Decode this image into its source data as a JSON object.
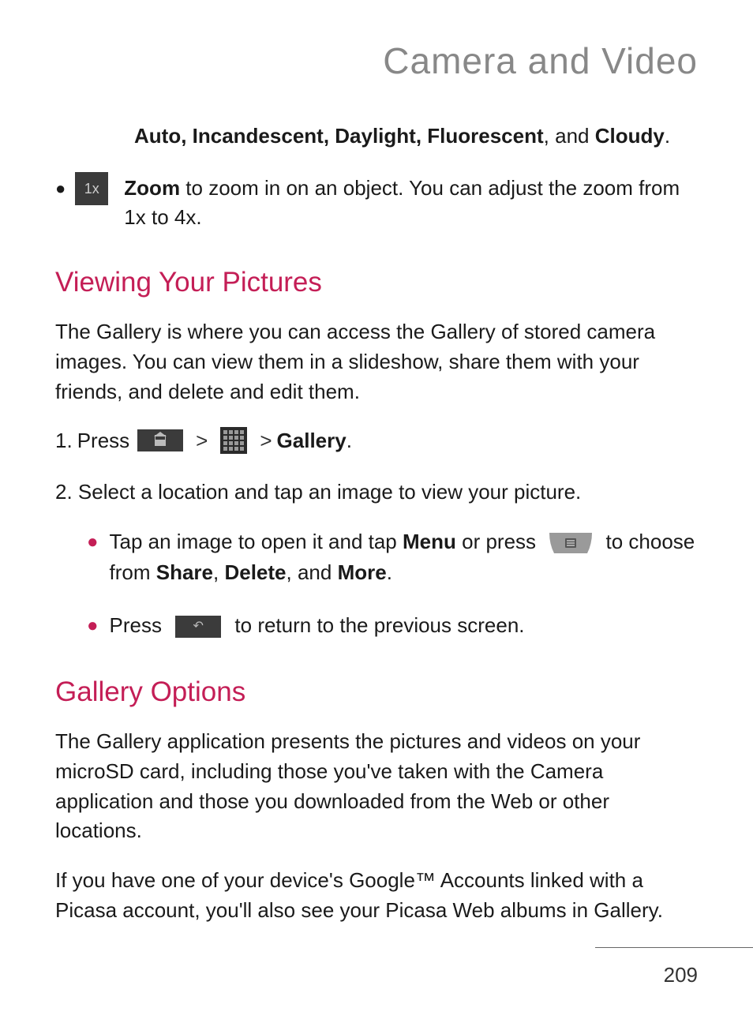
{
  "header": {
    "title": "Camera and Video"
  },
  "top_line": {
    "bold_part": "Auto, Incandescent, Daylight, Fluorescent",
    "rest": ", and ",
    "bold_end": "Cloudy",
    "period": "."
  },
  "zoom": {
    "icon_label": "1x",
    "bold": "Zoom",
    "text": " to zoom in on an object. You can adjust the zoom from 1x to 4x."
  },
  "section1": {
    "heading": "Viewing Your Pictures",
    "para": "The Gallery is where you can access the Gallery of stored camera images. You can view them in a slideshow, share them with your friends, and delete and edit them.",
    "step1_num": "1.",
    "step1_press": "Press",
    "step1_gallery": "Gallery",
    "step1_period": ".",
    "step2": "2. Select a location and tap an image to view your picture.",
    "bullet1_a": "Tap an image to open it and tap ",
    "bullet1_menu": "Menu",
    "bullet1_b": " or press ",
    "bullet1_c": " to choose from ",
    "bullet1_share": "Share",
    "bullet1_comma1": ", ",
    "bullet1_delete": "Delete",
    "bullet1_comma2": ", and ",
    "bullet1_more": "More",
    "bullet1_period": ".",
    "bullet2_a": "Press ",
    "bullet2_b": " to return to the previous screen."
  },
  "section2": {
    "heading": "Gallery Options",
    "para1": "The Gallery application presents the pictures and videos on your microSD card, including those you've taken with the Camera application and those you downloaded from the Web or other locations.",
    "para2": "If you have one of your device's Google™ Accounts linked with a Picasa account, you'll also see your Picasa Web albums in Gallery."
  },
  "page_number": "209",
  "angle": ">"
}
